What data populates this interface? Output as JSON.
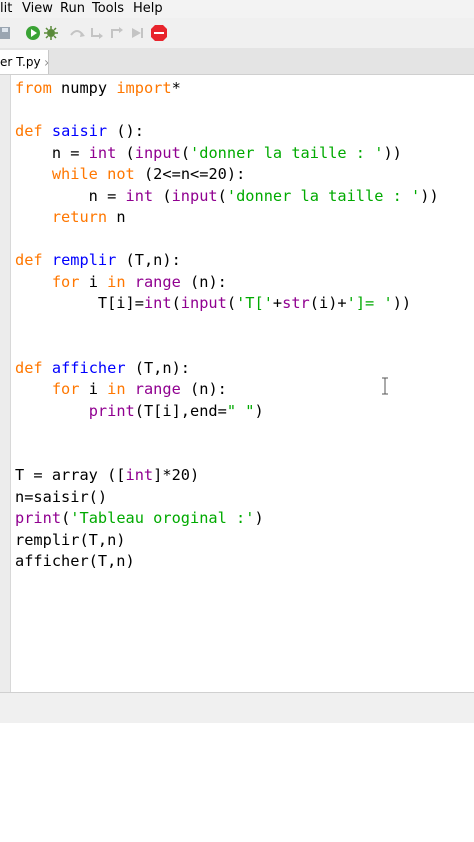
{
  "menu": [
    "lit",
    "View",
    "Run",
    "Tools",
    "Help"
  ],
  "toolbar": {
    "icons": [
      "save-icon",
      "run-icon",
      "debug-icon",
      "step-over-icon",
      "step-into-icon",
      "step-out-icon",
      "resume-icon",
      "stop-icon"
    ],
    "stop_color": "#e8242c",
    "run_color": "#3aa335"
  },
  "tab": {
    "label": "er T.py",
    "close": "×"
  },
  "code_lines": [
    "from numpy import*",
    "",
    "def saisir ():",
    "    n = int (input('donner la taille : '))",
    "    while not (2<=n<=20):",
    "        n = int (input('donner la taille : '))",
    "    return n",
    "",
    "def remplir (T,n):",
    "    for i in range (n):",
    "         T[i]=int(input('T['+str(i)+']= '))",
    "",
    "",
    "def afficher (T,n):",
    "    for i in range (n):",
    "        print(T[i],end=\" \")",
    "",
    "",
    "T = array ([int]*20)",
    "n=saisir()",
    "print('Tableau oroginal :')",
    "remplir(T,n)",
    "afficher(T,n)"
  ],
  "colors": {
    "keyword": "#ff7700",
    "builtin": "#900090",
    "string": "#00aa00",
    "definition": "#0000ff"
  }
}
